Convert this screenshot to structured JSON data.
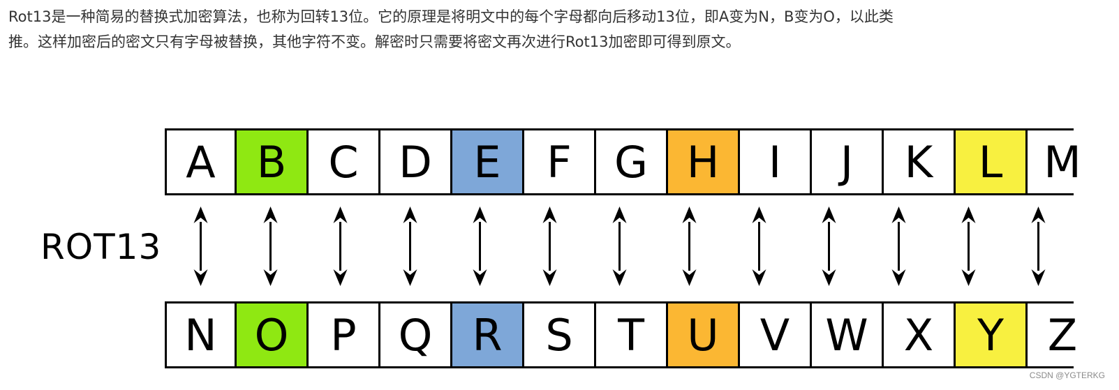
{
  "paragraph": {
    "line1": "Rot13是一种简易的替换式加密算法，也称为回转13位。它的原理是将明文中的每个字母都向后移动13位，即A变为N，B变为O，以此类",
    "line2": "推。这样加密后的密文只有字母被替换，其他字符不变。解密时只需要将密文再次进行Rot13加密即可得到原文。"
  },
  "diagram": {
    "label": "ROT13",
    "top_row": [
      "A",
      "B",
      "C",
      "D",
      "E",
      "F",
      "G",
      "H",
      "I",
      "J",
      "K",
      "L",
      "M"
    ],
    "bottom_row": [
      "N",
      "O",
      "P",
      "Q",
      "R",
      "S",
      "T",
      "U",
      "V",
      "W",
      "X",
      "Y",
      "Z"
    ],
    "highlights": [
      {
        "index": 1,
        "color": "#8FE812"
      },
      {
        "index": 4,
        "color": "#7EA7D8"
      },
      {
        "index": 7,
        "color": "#FBB733"
      },
      {
        "index": 11,
        "color": "#F8F040"
      }
    ]
  },
  "watermark": "CSDN @YGTERKG"
}
